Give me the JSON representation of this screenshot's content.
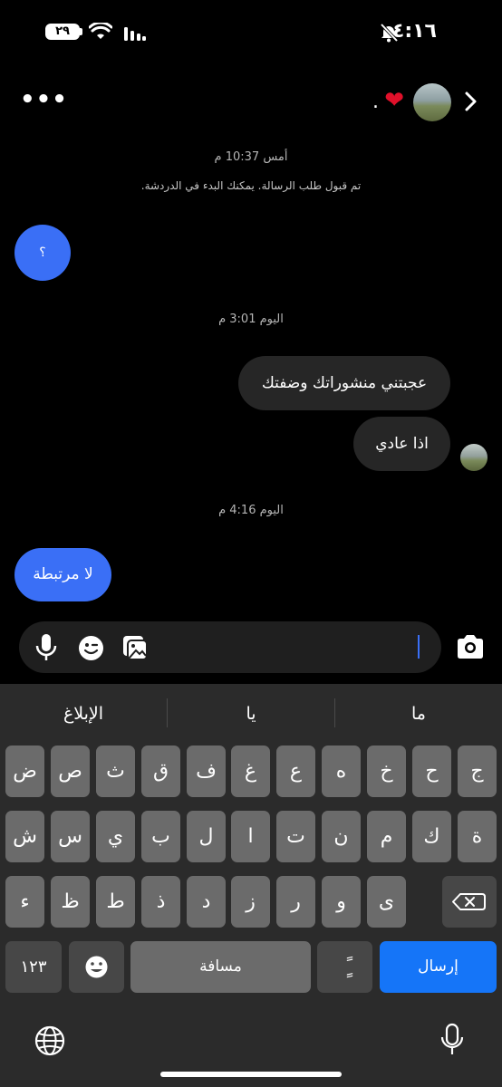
{
  "status_bar": {
    "time": "٤:١٦",
    "battery": "٢٩"
  },
  "header": {
    "trailing_dot": ".",
    "heart": "❤"
  },
  "messages": [
    {
      "type": "timestamp",
      "text": "أمس 10:37 م"
    },
    {
      "type": "system",
      "text": "تم قبول طلب الرسالة. يمكنك البدء في الدردشة."
    },
    {
      "type": "sent",
      "text": "؟"
    },
    {
      "type": "timestamp",
      "text": "اليوم 3:01 م"
    },
    {
      "type": "received",
      "text": "عجبتني منشوراتك وضفتك"
    },
    {
      "type": "received",
      "text": "اذا عادي"
    },
    {
      "type": "timestamp",
      "text": "اليوم 4:16 م"
    },
    {
      "type": "sent",
      "text": "لا مرتبطة"
    }
  ],
  "composer": {
    "value": ""
  },
  "keyboard": {
    "suggestions": [
      "ما",
      "يا",
      "الإبلاغ"
    ],
    "row1": [
      "ج",
      "ح",
      "خ",
      "ه",
      "ع",
      "غ",
      "ف",
      "ق",
      "ث",
      "ص",
      "ض"
    ],
    "row2": [
      "ة",
      "ك",
      "م",
      "ن",
      "ت",
      "ا",
      "ل",
      "ب",
      "ي",
      "س",
      "ش"
    ],
    "row3": [
      "ى",
      "و",
      "ر",
      "ز",
      "د",
      "ذ",
      "ط",
      "ظ",
      "ء"
    ],
    "numbers_key": "١٢٣",
    "space_key": "مسافة",
    "diacritic_key": "ًٍ",
    "send_key": "إرسال"
  },
  "colors": {
    "accent_blue": "#3a6ff6",
    "send_blue": "#1575f8",
    "heart_red": "#e0102a"
  }
}
